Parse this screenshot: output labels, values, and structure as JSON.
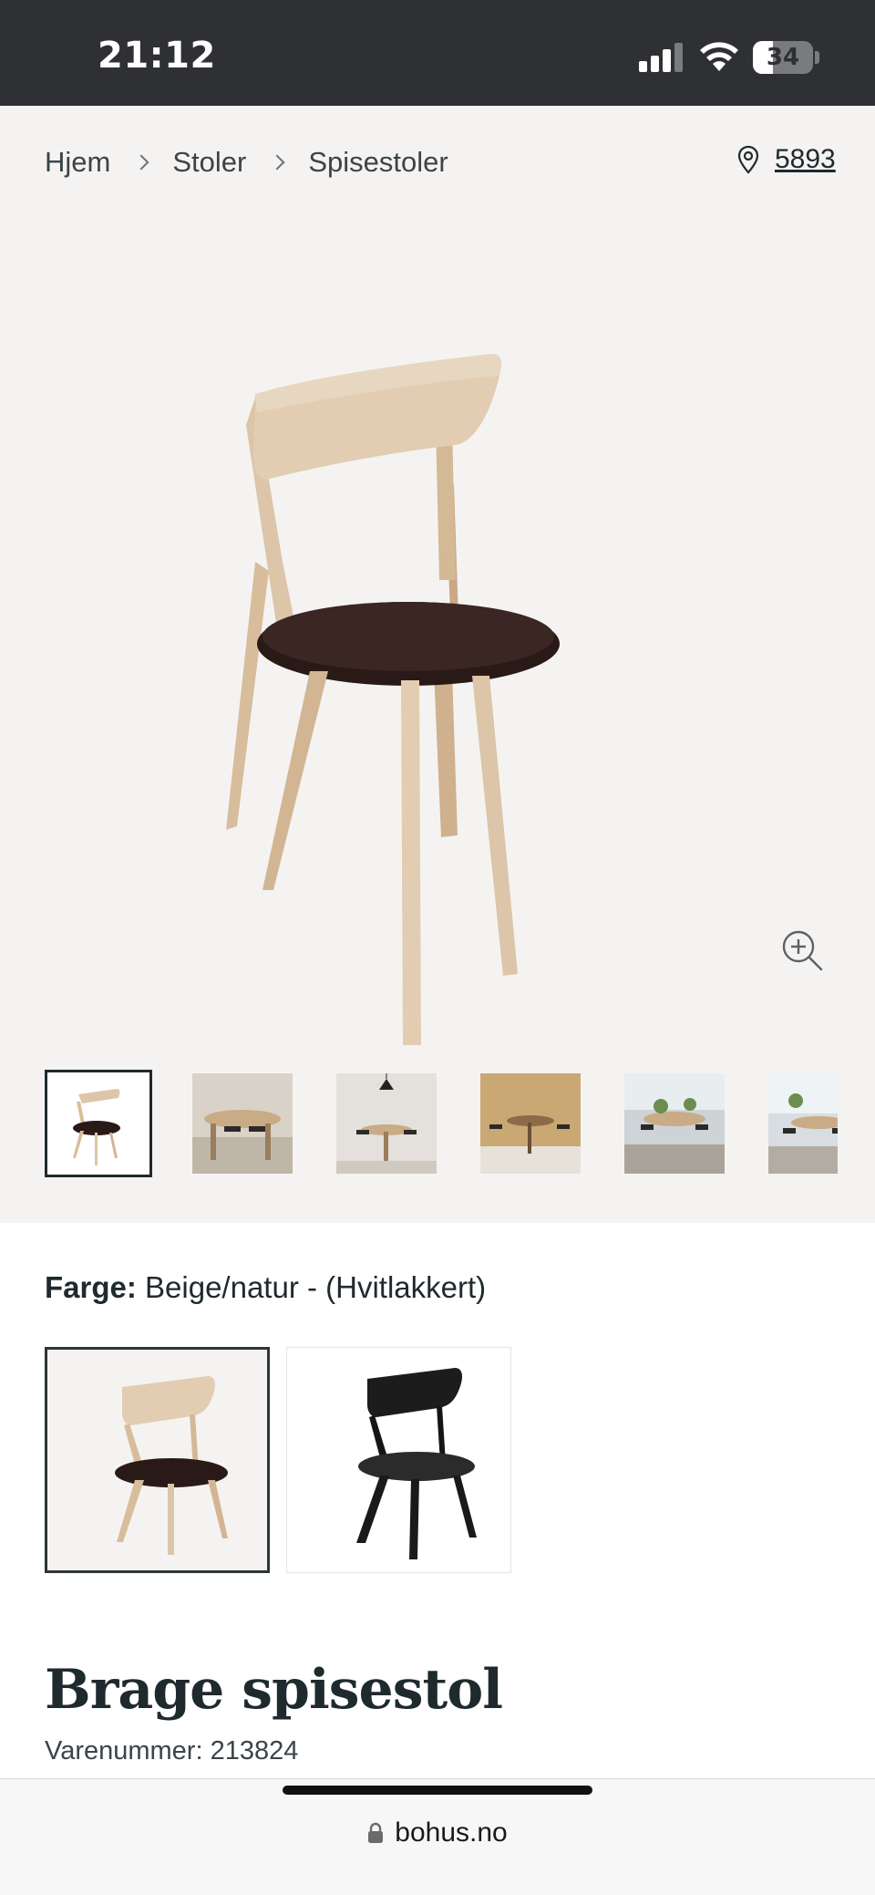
{
  "status_bar": {
    "time": "21:12",
    "battery": "34",
    "battery_level": 0.34,
    "signal_bars": 3,
    "icons": [
      "signal-icon",
      "wifi-icon",
      "battery-icon"
    ]
  },
  "breadcrumb": {
    "items": [
      "Hjem",
      "Stoler",
      "Spisestoler"
    ]
  },
  "store": {
    "icon": "location-pin-icon",
    "number": "5893"
  },
  "gallery": {
    "zoom_icon": "zoom-in-icon",
    "thumbnail_count": 6,
    "active_index": 0
  },
  "color": {
    "label": "Farge:",
    "value": "Beige/natur - (Hvitlakkert)",
    "options": [
      "beige-natur",
      "black"
    ]
  },
  "product": {
    "title": "Brage spisestol",
    "sku": "Varenummer: 213824"
  },
  "browser": {
    "url": "bohus.no",
    "lock_icon": "lock-icon"
  },
  "colors": {
    "status_bg": "#2f3033",
    "gallery_bg": "#f5f3f2",
    "text": "#1f2a2e",
    "wood": "#dcc5a8",
    "seat": "#2a1a17"
  }
}
